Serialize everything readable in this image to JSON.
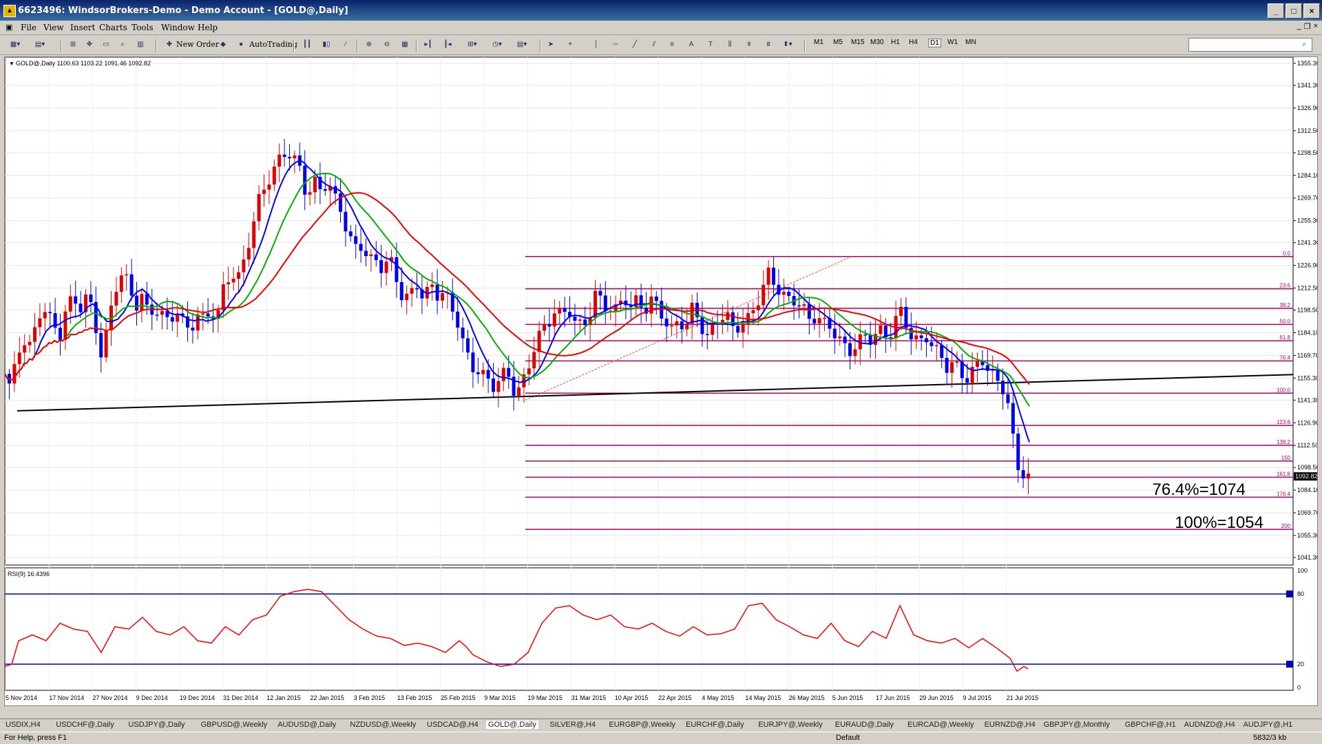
{
  "window": {
    "title": "6623496: WindsorBrokers-Demo - Demo Account - [GOLD@,Daily]"
  },
  "menu": [
    "File",
    "View",
    "Insert",
    "Charts",
    "Tools",
    "Window",
    "Help"
  ],
  "toolbar": {
    "new_order": "New Order",
    "autotrading": "AutoTrading",
    "timeframes": [
      "M1",
      "M5",
      "M15",
      "M30",
      "H1",
      "H4",
      "D1",
      "W1",
      "MN"
    ]
  },
  "chart": {
    "info": "GOLD@,Daily  1100.63 1103.22 1091.46 1092.82",
    "current_price": "1092.82",
    "price_ticks": [
      "1355.30",
      "1341.30",
      "1326.90",
      "1312.50",
      "1298.50",
      "1284.10",
      "1269.70",
      "1255.30",
      "1241.30",
      "1226.90",
      "1212.50",
      "1198.50",
      "1184.10",
      "1169.70",
      "1155.30",
      "1141.30",
      "1126.90",
      "1112.50",
      "1098.50",
      "1084.10",
      "1069.70",
      "1055.30",
      "1041.30"
    ],
    "date_ticks": [
      "5 Nov 2014",
      "17 Nov 2014",
      "27 Nov 2014",
      "9 Dec 2014",
      "19 Dec 2014",
      "31 Dec 2014",
      "12 Jan 2015",
      "22 Jan 2015",
      "3 Feb 2015",
      "13 Feb 2015",
      "25 Feb 2015",
      "9 Mar 2015",
      "19 Mar 2015",
      "31 Mar 2015",
      "10 Apr 2015",
      "22 Apr 2015",
      "4 May 2015",
      "14 May 2015",
      "26 May 2015",
      "5 Jun 2015",
      "17 Jun 2015",
      "29 Jun 2015",
      "9 Jul 2015",
      "21 Jul 2015"
    ],
    "fib_levels": [
      "0.0",
      "23.6",
      "38.2",
      "50.0",
      "61.8",
      "76.4",
      "100.0",
      "123.6",
      "138.2",
      "150",
      "161.8",
      "176.4",
      "200"
    ],
    "annotation_1": "76.4%=1074",
    "annotation_2": "100%=1054",
    "colors": {
      "bull": "#e00000",
      "bear": "#0000ee",
      "ma_fast": "#0000ff",
      "ma_mid": "#00b000",
      "ma_slow": "#ee0000",
      "fib": "#b0006a",
      "rsi": "#ff0000",
      "rsi_levels": "#0000b0"
    }
  },
  "rsi": {
    "label": "RSI(9) 16.4396",
    "ticks": [
      "100",
      "80",
      "20",
      "0"
    ]
  },
  "tabs": [
    "USDIX,H4",
    "USDCHF@,Daily",
    "USDJPY@,Daily",
    "GBPUSD@,Weekly",
    "AUDUSD@,Daily",
    "NZDUSD@,Weekly",
    "USDCAD@,H4",
    "GOLD@,Daily",
    "SILVER@,H4",
    "EURGBP@,Weekly",
    "EURCHF@,Daily",
    "EURJPY@,Weekly",
    "EURAUD@,Daily",
    "EURCAD@,Weekly",
    "EURNZD@,H4",
    "GBPJPY@,Monthly",
    "GBPCHF@,H1",
    "AUDNZD@,H4",
    "AUDJPY@,H1"
  ],
  "status": {
    "help": "For Help, press F1",
    "profile": "Default",
    "traffic": "5832/3 kb"
  }
}
